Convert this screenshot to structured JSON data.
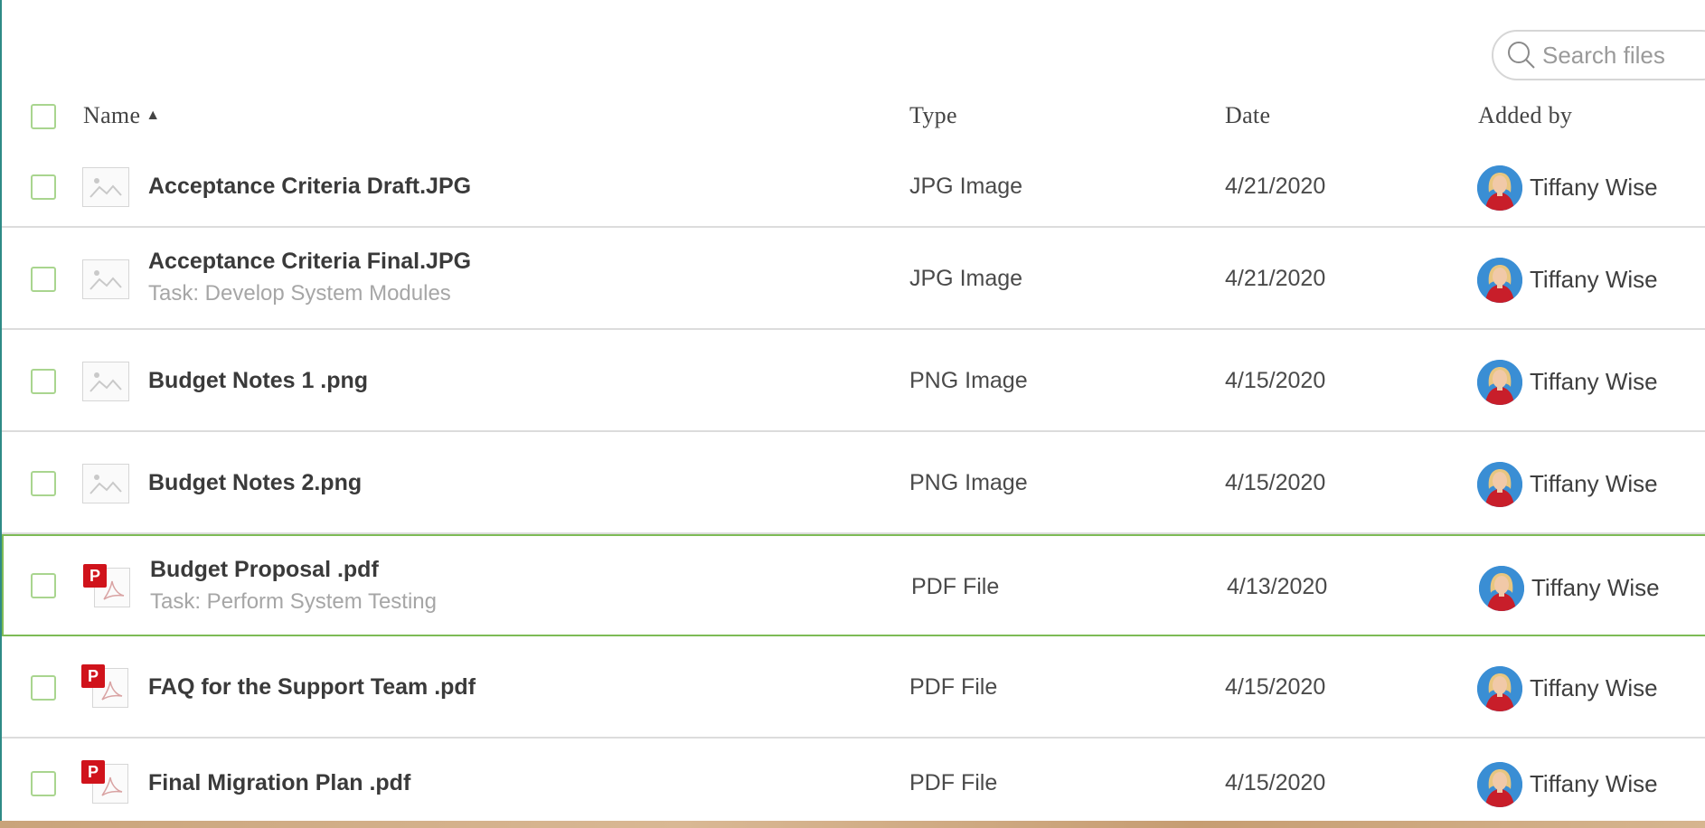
{
  "search": {
    "placeholder": "Search files"
  },
  "header": {
    "name": "Name",
    "sort_indicator": "▲",
    "type": "Type",
    "date": "Date",
    "added_by": "Added by"
  },
  "files": [
    {
      "name": "Acceptance Criteria Draft.JPG",
      "task": "",
      "type": "JPG Image",
      "date": "4/21/2020",
      "added_by": "Tiffany Wise",
      "icon": "image-icon"
    },
    {
      "name": "Acceptance Criteria Final.JPG",
      "task": "Task: Develop System Modules",
      "type": "JPG Image",
      "date": "4/21/2020",
      "added_by": "Tiffany Wise",
      "icon": "image-icon"
    },
    {
      "name": "Budget Notes 1 .png",
      "task": "",
      "type": "PNG Image",
      "date": "4/15/2020",
      "added_by": "Tiffany Wise",
      "icon": "image-icon"
    },
    {
      "name": "Budget Notes 2.png",
      "task": "",
      "type": "PNG Image",
      "date": "4/15/2020",
      "added_by": "Tiffany Wise",
      "icon": "image-icon"
    },
    {
      "name": "Budget Proposal .pdf",
      "task": "Task: Perform System Testing",
      "type": "PDF File",
      "date": "4/13/2020",
      "added_by": "Tiffany Wise",
      "icon": "pdf-icon",
      "selected": true
    },
    {
      "name": "FAQ for the Support Team .pdf",
      "task": "",
      "type": "PDF File",
      "date": "4/15/2020",
      "added_by": "Tiffany Wise",
      "icon": "pdf-icon"
    },
    {
      "name": "Final Migration Plan .pdf",
      "task": "",
      "type": "PDF File",
      "date": "4/15/2020",
      "added_by": "Tiffany Wise",
      "icon": "pdf-icon"
    }
  ],
  "pdf_badge": "P",
  "colors": {
    "accent_green": "#7dbb56",
    "checkbox_border": "#a9d58f",
    "pdf_red": "#d0131b",
    "left_edge": "#2e8a86"
  }
}
